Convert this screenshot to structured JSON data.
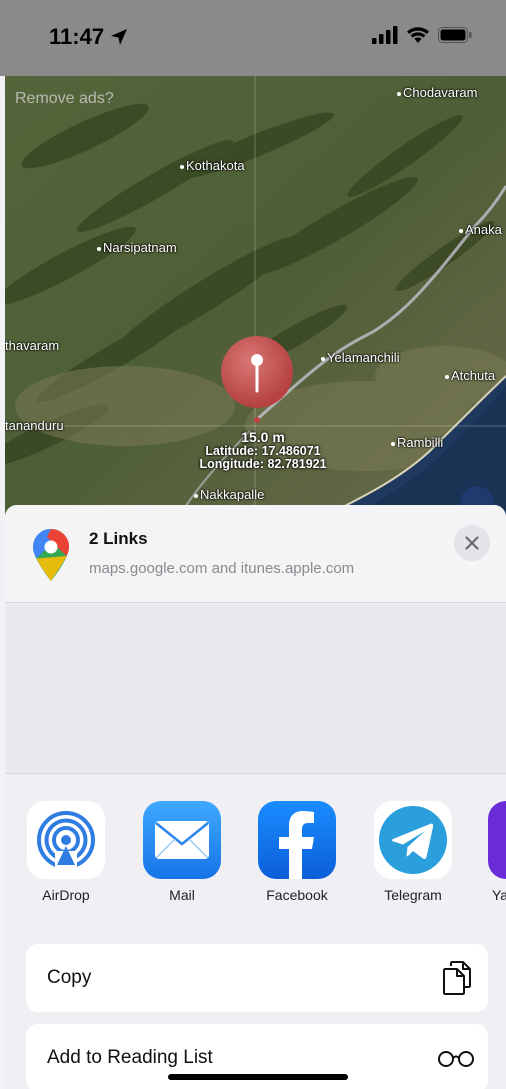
{
  "status_bar": {
    "time": "11:47"
  },
  "map": {
    "remove_ads": "Remove ads?",
    "places": [
      {
        "id": "chodavaram",
        "name": "Chodavaram"
      },
      {
        "id": "kothakota",
        "name": "Kothakota"
      },
      {
        "id": "narsipatnam",
        "name": "Narsipatnam"
      },
      {
        "id": "anaka",
        "name": "Anaka"
      },
      {
        "id": "thavaram",
        "name": "thavaram"
      },
      {
        "id": "yelamanchili",
        "name": "Yelamanchili"
      },
      {
        "id": "atchuta",
        "name": "Atchuta"
      },
      {
        "id": "tananduru",
        "name": "tananduru"
      },
      {
        "id": "rambilli",
        "name": "Rambilli"
      },
      {
        "id": "nakkapalle",
        "name": "Nakkapalle"
      }
    ],
    "pin": {
      "accuracy": "15.0 m",
      "latitude": "Latitude: 17.486071",
      "longitude": "Longitude: 82.781921"
    }
  },
  "share_sheet": {
    "title": "2 Links",
    "subtitle": "maps.google.com and itunes.apple.com",
    "apps": [
      {
        "label": "AirDrop",
        "icon": "airdrop-icon"
      },
      {
        "label": "Mail",
        "icon": "mail-icon"
      },
      {
        "label": "Facebook",
        "icon": "facebook-icon"
      },
      {
        "label": "Telegram",
        "icon": "telegram-icon"
      },
      {
        "label": "Ya",
        "icon": "yahoo-icon"
      }
    ],
    "actions": [
      {
        "label": "Copy",
        "icon": "copy-icon"
      },
      {
        "label": "Add to Reading List",
        "icon": "glasses-icon"
      }
    ]
  }
}
